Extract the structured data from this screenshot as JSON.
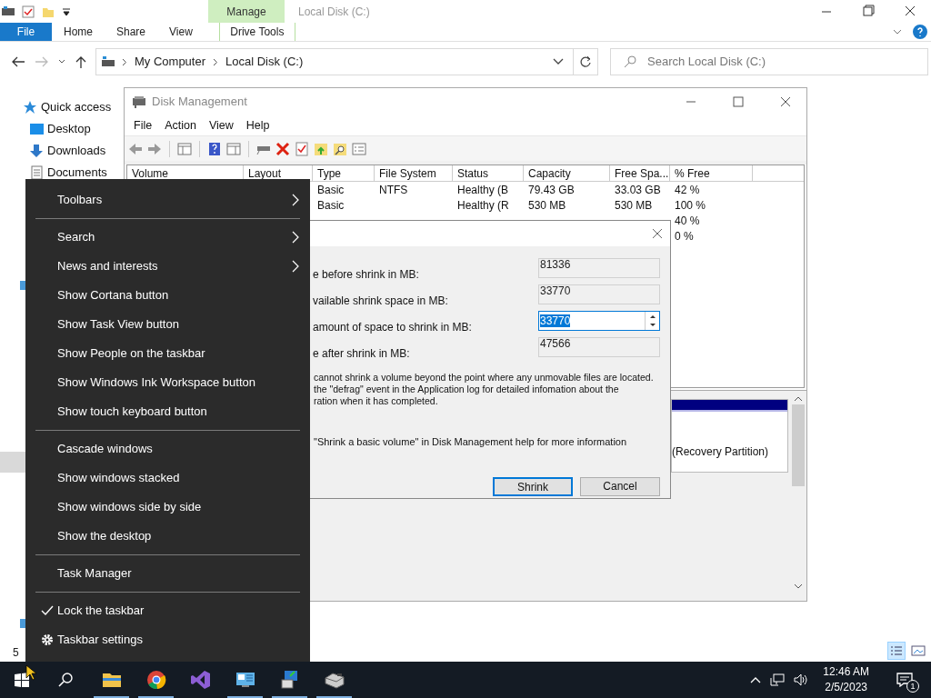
{
  "explorer": {
    "title": "Local Disk (C:)",
    "contextual_group": "Manage",
    "ribbon_tabs": [
      {
        "label": "File",
        "kind": "file"
      },
      {
        "label": "Home",
        "kind": "tab"
      },
      {
        "label": "Share",
        "kind": "tab"
      },
      {
        "label": "View",
        "kind": "tab"
      },
      {
        "label": "Drive Tools",
        "kind": "contextual"
      }
    ],
    "address": [
      "My Computer",
      "Local Disk (C:)"
    ],
    "search": {
      "placeholder": "Search Local Disk (C:)"
    },
    "nav": [
      {
        "label": "Quick access",
        "kind": "star"
      },
      {
        "label": "Desktop",
        "kind": "desktop"
      },
      {
        "label": "Downloads",
        "kind": "download"
      },
      {
        "label": "Documents",
        "kind": "document"
      }
    ],
    "status_text": "5"
  },
  "disk_management": {
    "title": "Disk Management",
    "menu": [
      "File",
      "Action",
      "View",
      "Help"
    ],
    "columns": [
      "Volume",
      "Layout",
      "Type",
      "File System",
      "Status",
      "Capacity",
      "Free Spa...",
      "% Free"
    ],
    "rows": [
      {
        "type": "Basic",
        "file_system": "NTFS",
        "status": "Healthy (B",
        "capacity": "79.43 GB",
        "free_space": "33.03 GB",
        "percent_free": "42 %"
      },
      {
        "type": "Basic",
        "status": "Healthy (R",
        "capacity": "530 MB",
        "free_space": "530 MB",
        "percent_free": "100 %"
      },
      {
        "percent_free": "40 %"
      },
      {
        "percent_free": "0 %"
      }
    ],
    "partition_label": "(Recovery Partition)"
  },
  "shrink_dialog": {
    "fields": [
      {
        "label": "e before shrink in MB:",
        "value": "81336",
        "kind": "readonly"
      },
      {
        "label": "vailable shrink space in MB:",
        "value": "33770",
        "kind": "readonly"
      },
      {
        "label": "amount of space to shrink in MB:",
        "value": "33770",
        "kind": "spin",
        "text_selected": true
      },
      {
        "label": "e after shrink in MB:",
        "value": "47566",
        "kind": "readonly"
      }
    ],
    "note_lines": [
      "cannot shrink a volume beyond the point where any unmovable files are located.",
      "the \"defrag\" event in the Application log for detailed infomation about the",
      "ration when it has completed."
    ],
    "help_text": "\"Shrink a basic volume\" in Disk Management help for more information",
    "buttons": [
      {
        "label": "Shrink",
        "default": true
      },
      {
        "label": "Cancel",
        "default": false
      }
    ]
  },
  "context_menu": {
    "sections": [
      [
        {
          "label": "Toolbars",
          "kind": "submenu"
        }
      ],
      [
        {
          "label": "Search",
          "kind": "submenu"
        },
        {
          "label": "News and interests",
          "kind": "submenu"
        },
        {
          "label": "Show Cortana button",
          "kind": "command"
        },
        {
          "label": "Show Task View button",
          "kind": "command"
        },
        {
          "label": "Show People on the taskbar",
          "kind": "command"
        },
        {
          "label": "Show Windows Ink Workspace button",
          "kind": "command"
        },
        {
          "label": "Show touch keyboard button",
          "kind": "command"
        }
      ],
      [
        {
          "label": "Cascade windows",
          "kind": "command"
        },
        {
          "label": "Show windows stacked",
          "kind": "command"
        },
        {
          "label": "Show windows side by side",
          "kind": "command"
        },
        {
          "label": "Show the desktop",
          "kind": "command"
        }
      ],
      [
        {
          "label": "Task Manager",
          "kind": "command"
        }
      ],
      [
        {
          "label": "Lock the taskbar",
          "kind": "toggle",
          "checked": true
        },
        {
          "label": "Taskbar settings",
          "kind": "settings"
        }
      ]
    ]
  },
  "taskbar": {
    "apps": [
      {
        "kind": "folder",
        "running": true
      },
      {
        "kind": "chrome",
        "running": true
      },
      {
        "kind": "studio",
        "running": false
      },
      {
        "kind": "computer",
        "running": true
      },
      {
        "kind": "network",
        "running": true
      },
      {
        "kind": "drive",
        "running": true
      }
    ],
    "time": "12:46 AM",
    "date": "2/5/2023",
    "notification_count": "1"
  }
}
